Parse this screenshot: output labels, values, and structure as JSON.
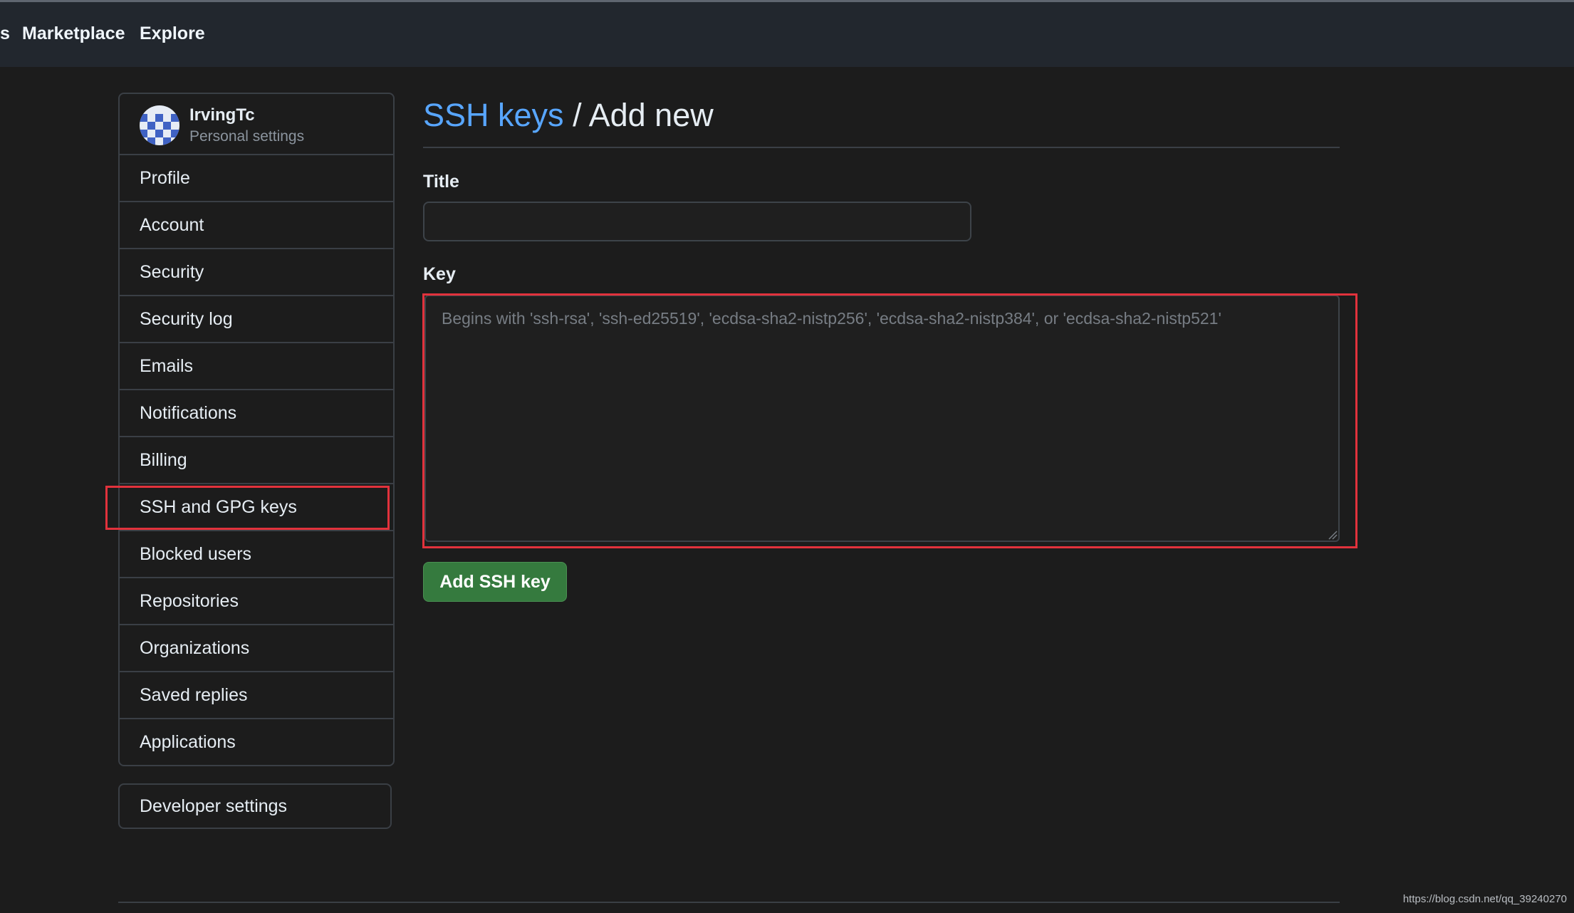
{
  "header": {
    "edge_fragment": "s",
    "nav": [
      {
        "label": "Marketplace"
      },
      {
        "label": "Explore"
      }
    ]
  },
  "sidebar": {
    "username": "IrvingTc",
    "subtitle": "Personal settings",
    "items": [
      {
        "label": "Profile"
      },
      {
        "label": "Account"
      },
      {
        "label": "Security"
      },
      {
        "label": "Security log"
      },
      {
        "label": "Emails"
      },
      {
        "label": "Notifications"
      },
      {
        "label": "Billing"
      },
      {
        "label": "SSH and GPG keys",
        "highlighted": true
      },
      {
        "label": "Blocked users"
      },
      {
        "label": "Repositories"
      },
      {
        "label": "Organizations"
      },
      {
        "label": "Saved replies"
      },
      {
        "label": "Applications"
      }
    ],
    "developer_settings": "Developer settings"
  },
  "main": {
    "breadcrumb": {
      "link": "SSH keys",
      "separator": " / ",
      "current": "Add new"
    },
    "title_label": "Title",
    "title_value": "",
    "key_label": "Key",
    "key_placeholder": "Begins with 'ssh-rsa', 'ssh-ed25519', 'ecdsa-sha2-nistp256', 'ecdsa-sha2-nistp384', or 'ecdsa-sha2-nistp521'",
    "submit_label": "Add SSH key"
  },
  "watermark": "https://blog.csdn.net/qq_39240270",
  "colors": {
    "link": "#58a6ff",
    "highlight": "#e1323c",
    "button": "#357a3e"
  }
}
